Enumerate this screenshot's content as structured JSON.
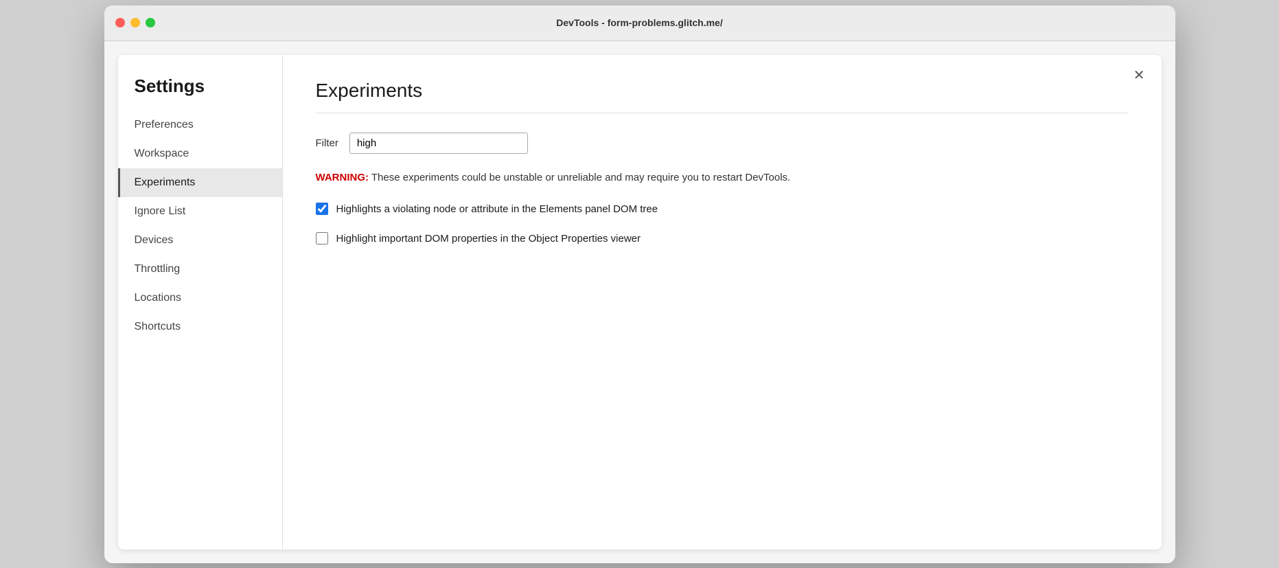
{
  "window": {
    "title": "DevTools - form-problems.glitch.me/"
  },
  "sidebar": {
    "heading": "Settings",
    "items": [
      {
        "id": "preferences",
        "label": "Preferences",
        "active": false
      },
      {
        "id": "workspace",
        "label": "Workspace",
        "active": false
      },
      {
        "id": "experiments",
        "label": "Experiments",
        "active": true
      },
      {
        "id": "ignore-list",
        "label": "Ignore List",
        "active": false
      },
      {
        "id": "devices",
        "label": "Devices",
        "active": false
      },
      {
        "id": "throttling",
        "label": "Throttling",
        "active": false
      },
      {
        "id": "locations",
        "label": "Locations",
        "active": false
      },
      {
        "id": "shortcuts",
        "label": "Shortcuts",
        "active": false
      }
    ]
  },
  "main": {
    "title": "Experiments",
    "close_label": "✕",
    "filter": {
      "label": "Filter",
      "value": "high",
      "placeholder": ""
    },
    "warning": {
      "prefix": "WARNING:",
      "text": " These experiments could be unstable or unreliable and may require you to restart DevTools."
    },
    "experiments": [
      {
        "id": "highlight-violation",
        "label": "Highlights a violating node or attribute in the Elements panel DOM tree",
        "checked": true
      },
      {
        "id": "highlight-dom-properties",
        "label": "Highlight important DOM properties in the Object Properties viewer",
        "checked": false
      }
    ]
  },
  "traffic_lights": {
    "close_color": "#ff5f57",
    "minimize_color": "#febc2e",
    "maximize_color": "#28c840"
  }
}
